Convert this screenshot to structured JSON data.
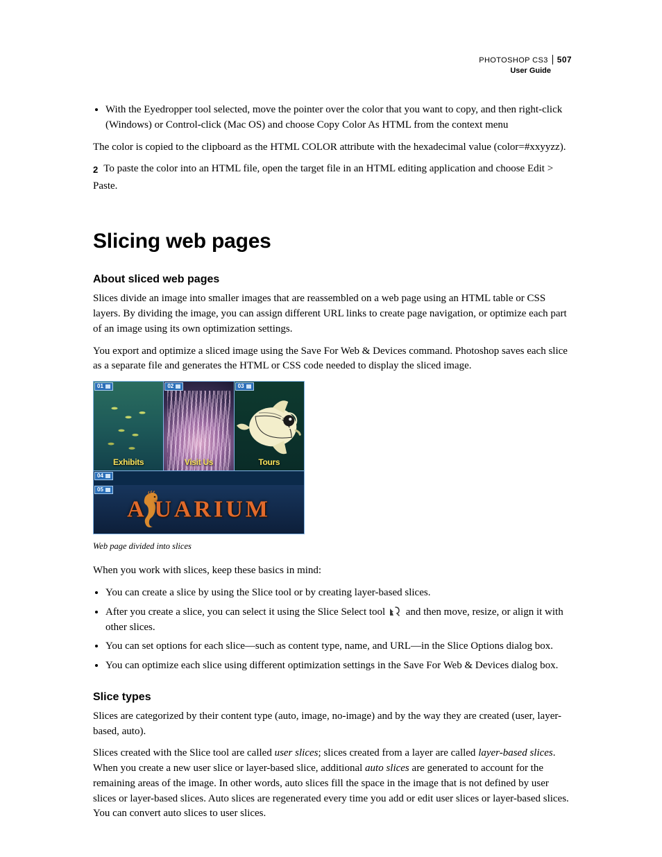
{
  "header": {
    "product": "PHOTOSHOP CS3",
    "doc": "User Guide",
    "page": "507"
  },
  "intro": {
    "bullet1": "With the Eyedropper tool selected, move the pointer over the color that you want to copy, and then right-click (Windows) or Control-click (Mac OS) and choose Copy Color As HTML from the context menu",
    "para1": "The color is copied to the clipboard as the HTML COLOR attribute with the hexadecimal value (color=#xxyyzz).",
    "step2": "To paste the color into an HTML file, open the target file in an HTML editing application and choose Edit > Paste."
  },
  "section_title": "Slicing web pages",
  "about": {
    "heading": "About sliced web pages",
    "p1": "Slices divide an image into smaller images that are reassembled on a web page using an HTML table or CSS layers. By dividing the image, you can assign different URL links to create page navigation, or optimize each part of an image using its own optimization settings.",
    "p2": "You export and optimize a sliced image using the Save For Web & Devices command. Photoshop saves each slice as a separate file and generates the HTML or CSS code needed to display the sliced image."
  },
  "figure": {
    "slice_badges": [
      "01",
      "02",
      "03",
      "04",
      "05"
    ],
    "thumb_labels": [
      "Exhibits",
      "Visit Us",
      "Tours"
    ],
    "logo_text": "A   UARIUM",
    "caption": "Web page divided into slices"
  },
  "basics": {
    "lead": "When you work with slices, keep these basics in mind:",
    "b1": "You can create a slice by using the Slice tool or by creating layer-based slices.",
    "b2a": "After you create a slice, you can select it using the Slice Select tool ",
    "b2b": " and then move, resize, or align it with other slices.",
    "b3": "You can set options for each slice—such as content type, name, and URL—in the Slice Options dialog box.",
    "b4": "You can optimize each slice using different optimization settings in the Save For Web & Devices dialog box."
  },
  "types": {
    "heading": "Slice types",
    "p1": "Slices are categorized by their content type (auto, image, no-image) and by the way they are created (user, layer-based, auto).",
    "p2a": "Slices created with the Slice tool are called ",
    "term_user": "user slices",
    "p2b": "; slices created from a layer are called ",
    "term_layer": "layer-based slices",
    "p2c": ". When you create a new user slice or layer-based slice, additional ",
    "term_auto": "auto slices",
    "p2d": " are generated to account for the remaining areas of the image. In other words, auto slices fill the space in the image that is not defined by user slices or layer-based slices. Auto slices are regenerated every time you add or edit user slices or layer-based slices. You can convert auto slices to user slices."
  }
}
